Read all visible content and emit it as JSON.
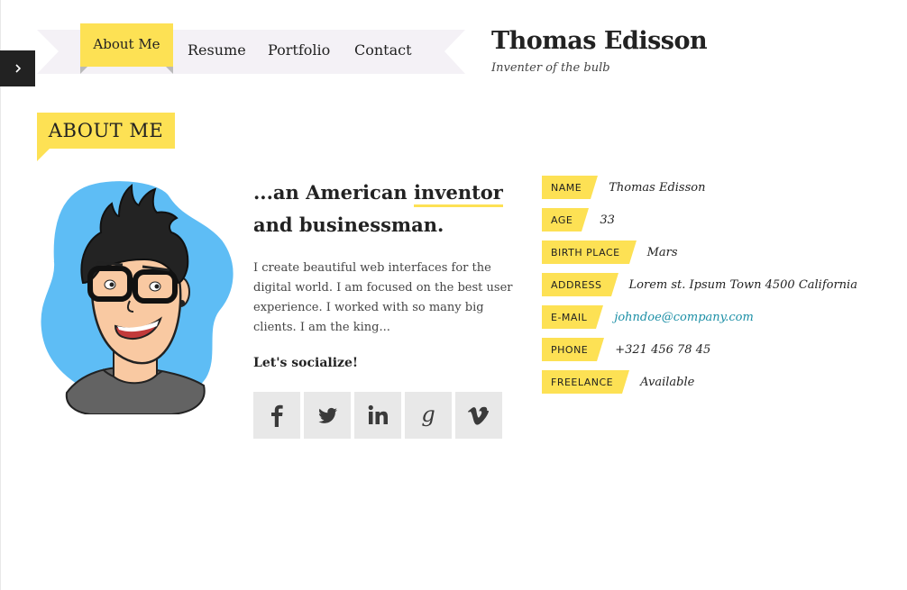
{
  "nav": {
    "items": [
      {
        "label": "About Me",
        "active": true
      },
      {
        "label": "Resume"
      },
      {
        "label": "Portfolio"
      },
      {
        "label": "Contact"
      }
    ]
  },
  "brand": {
    "name": "Thomas Edisson",
    "tagline": "Inventer of the bulb"
  },
  "section": {
    "title": "ABOUT ME"
  },
  "intro": {
    "headline_prefix": "...an American ",
    "headline_highlight": "inventor",
    "headline_suffix": "and businessman.",
    "bio": "I create beautiful web interfaces for the digital world. I am focused on the best user experience. I worked with so many big clients. I am the king...",
    "social_title": "Let's socialize!"
  },
  "social": [
    {
      "icon": "facebook-icon"
    },
    {
      "icon": "twitter-icon"
    },
    {
      "icon": "linkedin-icon"
    },
    {
      "icon": "google-icon"
    },
    {
      "icon": "vimeo-icon"
    }
  ],
  "info": [
    {
      "label": "NAME",
      "value": "Thomas Edisson"
    },
    {
      "label": "AGE",
      "value": "33"
    },
    {
      "label": "BIRTH PLACE",
      "value": "Mars"
    },
    {
      "label": "ADDRESS",
      "value": "Lorem st. Ipsum Town 4500 California"
    },
    {
      "label": "E-MAIL",
      "value": "johndoe@company.com"
    },
    {
      "label": "PHONE",
      "value": "+321 456 78 45"
    },
    {
      "label": "FREELANCE",
      "value": "Available"
    }
  ],
  "colors": {
    "accent": "#fde154",
    "dark": "#222222",
    "link": "#1b8fa6",
    "social_bg": "#e8e8e8",
    "avatar_blob": "#5ebdf5"
  }
}
